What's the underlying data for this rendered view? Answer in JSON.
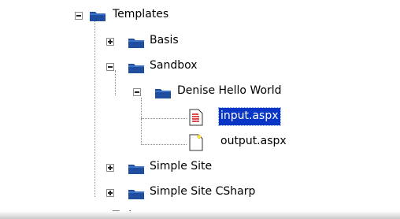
{
  "tree": {
    "templates": {
      "label": "Templates"
    },
    "basis": {
      "label": "Basis"
    },
    "sandbox": {
      "label": "Sandbox"
    },
    "denise": {
      "label": "Denise Hello World"
    },
    "input": {
      "label": "input.aspx"
    },
    "output": {
      "label": "output.aspx"
    },
    "simple_site": {
      "label": "Simple Site"
    },
    "simple_site_csharp": {
      "label": "Simple Site CSharp"
    },
    "partial_bottom": {
      "label": "T...l"
    }
  },
  "colors": {
    "folder_body": "#1f4e9e",
    "folder_top": "#3e74c7",
    "selection": "#0a36c8"
  },
  "icons": {
    "expand": "plus-box-icon",
    "collapse": "minus-box-icon",
    "folder": "folder-icon",
    "doc_red": "aspx-document-icon",
    "doc_new": "new-document-icon"
  }
}
